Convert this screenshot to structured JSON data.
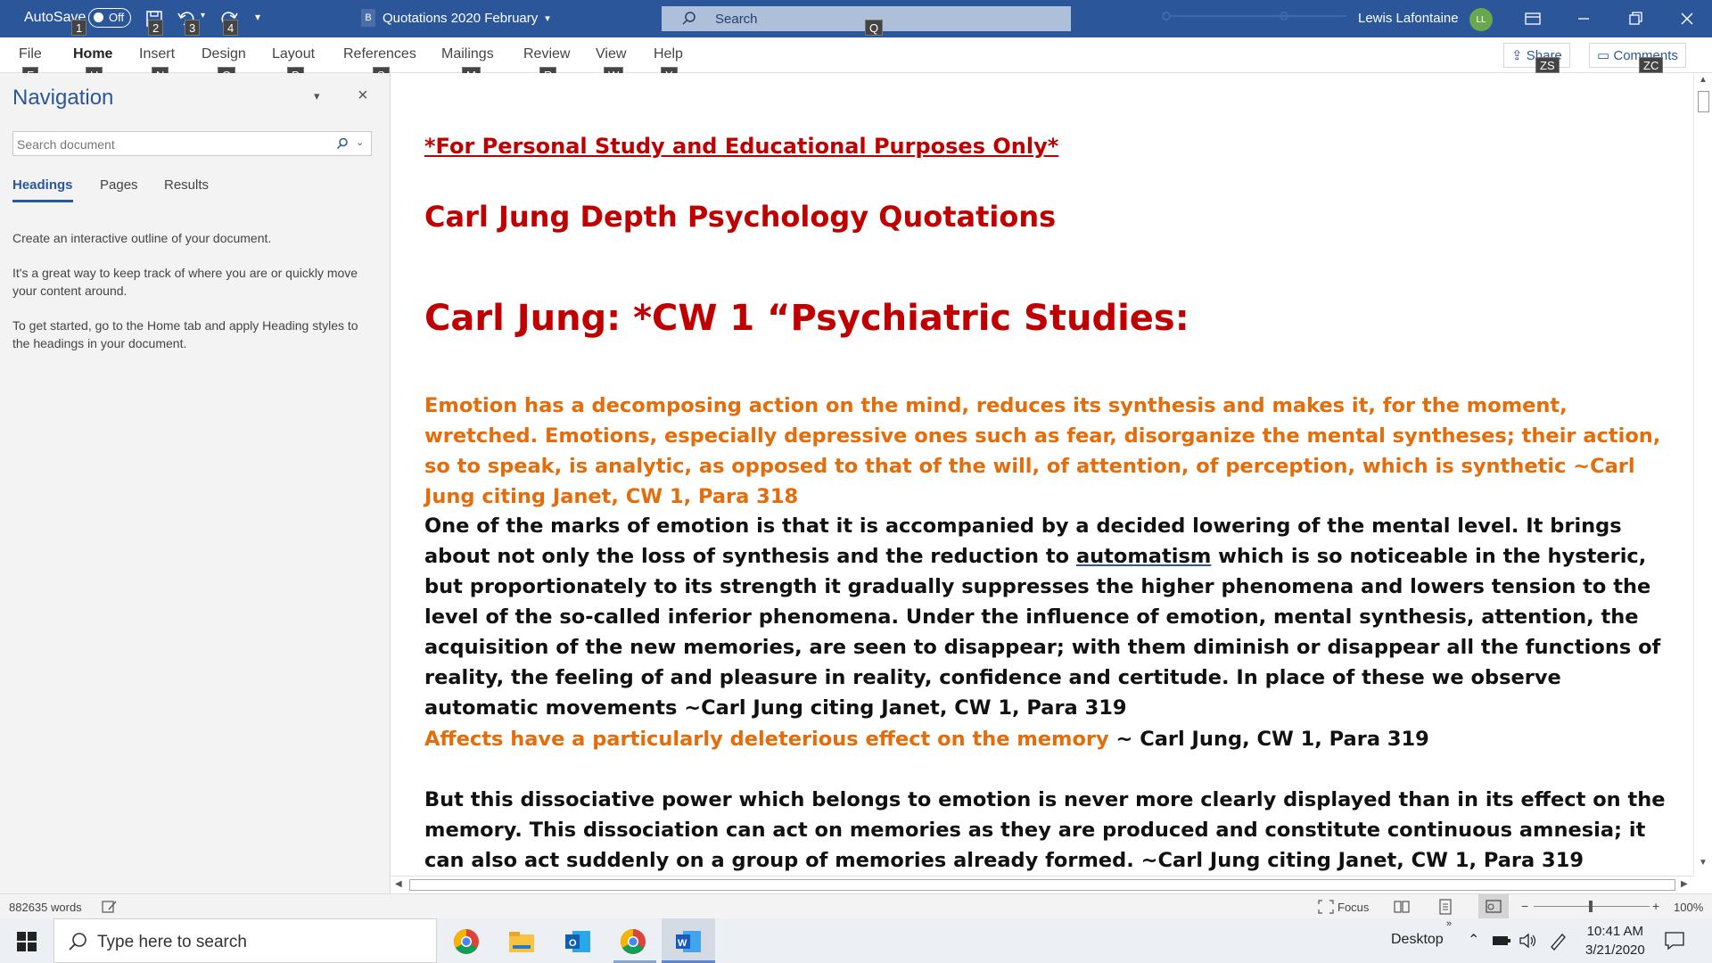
{
  "titlebar": {
    "autosave_label": "AutoSave",
    "autosave_state": "Off",
    "doc_badge": "B",
    "doc_title": "Quotations 2020 February",
    "search_placeholder": "Search",
    "search_keytip": "Q",
    "user_name": "Lewis Lafontaine",
    "user_initials": "LL",
    "qat_keytips": [
      "1",
      "2",
      "3",
      "4"
    ]
  },
  "ribbon": {
    "tabs": [
      {
        "label": "File",
        "keytip": "F"
      },
      {
        "label": "Home",
        "keytip": "H"
      },
      {
        "label": "Insert",
        "keytip": "N"
      },
      {
        "label": "Design",
        "keytip": "G"
      },
      {
        "label": "Layout",
        "keytip": "P"
      },
      {
        "label": "References",
        "keytip": "S"
      },
      {
        "label": "Mailings",
        "keytip": "M"
      },
      {
        "label": "Review",
        "keytip": "R"
      },
      {
        "label": "View",
        "keytip": "W"
      },
      {
        "label": "Help",
        "keytip": "Y"
      }
    ],
    "share_label": "Share",
    "share_keytip": "ZS",
    "comments_label": "Comments",
    "comments_keytip": "ZC"
  },
  "navigation": {
    "title": "Navigation",
    "search_placeholder": "Search document",
    "tabs": [
      "Headings",
      "Pages",
      "Results"
    ],
    "active_tab": "Headings",
    "help": [
      "Create an interactive outline of your document.",
      "It's a great way to keep track of where you are or quickly move your content around.",
      "To get started, go to the Home tab and apply Heading styles to the headings in your document."
    ]
  },
  "document": {
    "disclaimer": "*For Personal Study and Educational Purposes Only*",
    "heading1": "Carl Jung Depth Psychology Quotations",
    "heading2": "Carl Jung: *CW 1 “Psychiatric Studies:",
    "para1": "Emotion has a decomposing action on the mind, reduces its synthesis and makes it, for the moment, wretched. Emotions, especially depressive ones such as fear, disorganize the mental syntheses; their action, so to speak, is analytic, as opposed to that of the will, of attention, of perception, which is synthetic ~Carl Jung citing Janet, CW 1, Para 318",
    "para2_a": "One of the marks of emotion is that it is accompanied by a decided lowering of the mental level. It brings about not only the loss of synthesis and the reduction to ",
    "para2_link": "automatism",
    "para2_b": " which is so noticeable in the hysteric, but proportionately to its strength it gradually suppresses the higher phenomena and lowers tension to the level of the so-called inferior phenomena. Under the influence of emotion, mental synthesis, attention, the acquisition of the new memories, are seen to disappear; with them diminish or disappear all the functions of reality, the feeling of and pleasure in reality, confidence and certitude. In place of these we observe automatic movements ~Carl Jung citing Janet, CW 1, Para 319",
    "para3_orange": "Affects have a particularly deleterious effect on the memory",
    "para3_black": " ~ Carl Jung, CW 1, Para 319",
    "para4": "But this dissociative power which belongs to emotion is never more clearly displayed than in its effect on the memory. This dissociation can act on memories as they are produced and constitute continuous amnesia; it can also act suddenly on a group of memories already formed. ~Carl Jung citing Janet, CW 1, Para 319"
  },
  "statusbar": {
    "word_count": "882635 words",
    "focus_label": "Focus",
    "zoom": "100%",
    "zoom_minus": "−",
    "zoom_plus": "+"
  },
  "taskbar": {
    "search_placeholder": "Type here to search",
    "desktop_label": "Desktop",
    "time": "10:41 AM",
    "date": "3/21/2020"
  },
  "colors": {
    "word_blue": "#2b579a",
    "heading_red": "#c00000",
    "quote_orange": "#e46c0a"
  }
}
